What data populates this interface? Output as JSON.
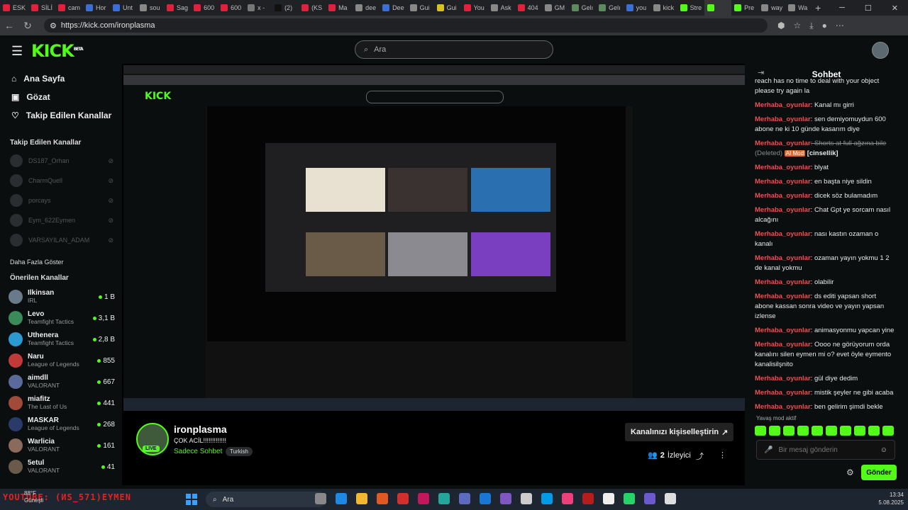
{
  "browser": {
    "tabs": [
      "ESK",
      "SİLİ",
      "cam",
      "Hor",
      "Unt",
      "sou",
      "Sag",
      "600",
      "600",
      "x -",
      "(2)",
      "(KS",
      "Ma",
      "dee",
      "Dee",
      "Gui",
      "Gui",
      "You",
      "Ask",
      "404",
      "GM",
      "Gelı",
      "Gelı",
      "you",
      "kick",
      "Stre",
      "",
      "Pre",
      "way",
      "Wa"
    ],
    "tab_colors": [
      "#e0213b",
      "#e0213b",
      "#e0213b",
      "#3a6ed8",
      "#3a6ed8",
      "#888888",
      "#e0213b",
      "#e0213b",
      "#e0213b",
      "#777777",
      "#111111",
      "#e0213b",
      "#e0213b",
      "#888888",
      "#3a6ed8",
      "#888888",
      "#d8c020",
      "#e0213b",
      "#888888",
      "#e0213b",
      "#888888",
      "#5c8a5c",
      "#5c8a5c",
      "#3a6ed8",
      "#888888",
      "#53fc18",
      "#53fc18",
      "#53fc18",
      "#888888",
      "#888888"
    ],
    "active_tab_index": 26,
    "new_tab_icon": "plus-icon",
    "url": "https://kick.com/ironplasma"
  },
  "kick": {
    "logo": "KICK",
    "logo_sup": "BETA",
    "search_placeholder": "Ara"
  },
  "sidebar": {
    "nav": [
      {
        "label": "Ana Sayfa",
        "icon": "home-icon"
      },
      {
        "label": "Gözat",
        "icon": "browse-icon"
      },
      {
        "label": "Takip Edilen Kanallar",
        "icon": "heart-icon"
      }
    ],
    "followed_heading": "Takip Edilen Kanallar",
    "followed": [
      "DS187_Orhan",
      "CharmQuell",
      "porcays",
      "Eym_622Eymen",
      "VARSAYILAN_ADAM"
    ],
    "show_more": "Daha Fazla Göster",
    "recommended_heading": "Önerilen Kanallar",
    "recommended": [
      {
        "name": "Ilkinsan",
        "game": "IRL",
        "viewers": "1 B"
      },
      {
        "name": "Levo",
        "game": "Teamfight Tactics",
        "viewers": "3,1 B"
      },
      {
        "name": "Uthenera",
        "game": "Teamfight Tactics",
        "viewers": "2,8 B"
      },
      {
        "name": "Naru",
        "game": "League of Legends",
        "viewers": "855"
      },
      {
        "name": "aimdll",
        "game": "VALORANT",
        "viewers": "667"
      },
      {
        "name": "miafitz",
        "game": "The Last of Us",
        "viewers": "441"
      },
      {
        "name": "MASKAR",
        "game": "League of Legends",
        "viewers": "268"
      },
      {
        "name": "Warlicia",
        "game": "VALORANT",
        "viewers": "161"
      },
      {
        "name": "5etul",
        "game": "VALORANT",
        "viewers": "41"
      }
    ]
  },
  "stream": {
    "streamer": "ironplasma",
    "live": "LIVE",
    "title": "ÇOK ACİL!!!!!!!!!!!!!",
    "category": "Sadece Sohbet",
    "language": "Turkish",
    "customize": "Kanalınızı kişiselleştirin",
    "viewers_count": "2",
    "viewers_label": "İzleyici"
  },
  "chat": {
    "header": "Sohbet",
    "messages": [
      {
        "user": "",
        "text": "reach has no time to deal with your object please try again la"
      },
      {
        "user": "Merhaba_oyunlar",
        "text": ": Kanal mı girri"
      },
      {
        "user": "Merhaba_oyunlar",
        "text": ": sen demiyomuydun 600 abone ne ki 10 günde kasarım diye"
      },
      {
        "user": "Merhaba_oyunlar",
        "text": ": Shorts at full ağzına bile",
        "deleted": "(Deleted)",
        "badge": "AI Mod",
        "tag": "[cinsellik]"
      },
      {
        "user": "Merhaba_oyunlar",
        "text": ": blyat"
      },
      {
        "user": "Merhaba_oyunlar",
        "text": ": en başta niye sildin"
      },
      {
        "user": "Merhaba_oyunlar",
        "text": ": dicek söz bulamadım"
      },
      {
        "user": "Merhaba_oyunlar",
        "text": ": Chat Gpt ye sorcam nasıl alcağını"
      },
      {
        "user": "Merhaba_oyunlar",
        "text": ": nası kastın ozaman o kanalı"
      },
      {
        "user": "Merhaba_oyunlar",
        "text": ": ozaman yayın yokmu 1 2 de kanal yokmu"
      },
      {
        "user": "Merhaba_oyunlar",
        "text": ": olabilir"
      },
      {
        "user": "Merhaba_oyunlar",
        "text": ": ds editi yapsan short abone kassan sonra video ve yayın yapsan izlense"
      },
      {
        "user": "Merhaba_oyunlar",
        "text": ": animasyonmu yapcan yine"
      },
      {
        "user": "Merhaba_oyunlar",
        "text": ": Oooo ne görüyorum orda kanalını silen eymen mi o? evet öyle eymento kanalisilşnito"
      },
      {
        "user": "Merhaba_oyunlar",
        "text": ": gül diye dedim"
      },
      {
        "user": "Merhaba_oyunlar",
        "text": ": mistik şeyler ne gibi acaba"
      },
      {
        "user": "Merhaba_oyunlar",
        "text": ": ben gelirim şimdi bekle"
      }
    ],
    "slow_mode": "Yavaş mod aktif",
    "input_placeholder": "Bir mesaj gönderin",
    "send": "Gönder"
  },
  "taskbar": {
    "overlay_text": "YOUTUBE: (ИS_571)EYMEN",
    "weather_temp": "88°F",
    "weather_desc": "Güneşli",
    "search": "Ara",
    "time": "13:34",
    "date": "5.08.2025"
  }
}
